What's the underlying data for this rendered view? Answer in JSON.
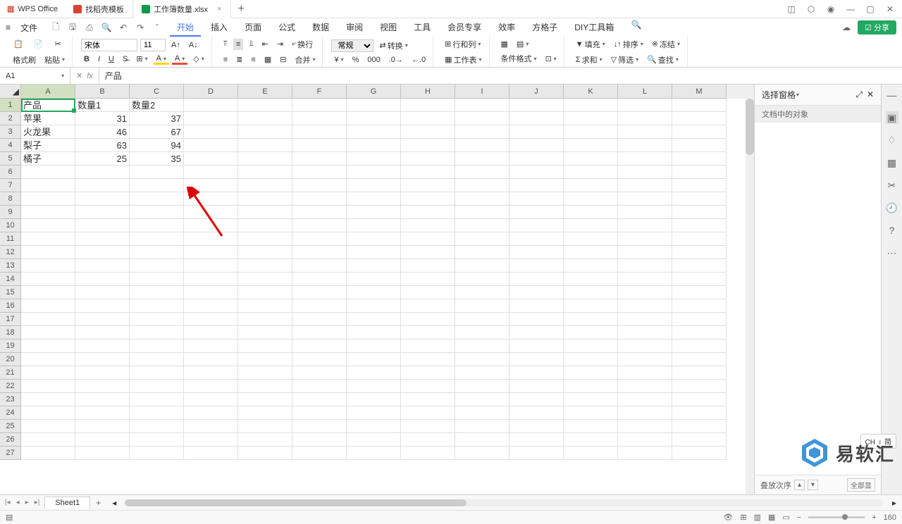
{
  "title_bar": {
    "app_name": "WPS Office",
    "tabs": [
      {
        "icon": "red",
        "label": "找稻壳模板",
        "closable": false
      },
      {
        "icon": "green",
        "label": "工作簿数量.xlsx",
        "closable": true
      }
    ]
  },
  "menu": {
    "file": "文件",
    "tabs": [
      "开始",
      "插入",
      "页面",
      "公式",
      "数据",
      "审阅",
      "视图",
      "工具",
      "会员专享",
      "效率",
      "方格子",
      "DIY工具箱"
    ],
    "active_tab": "开始",
    "share": "分享"
  },
  "ribbon": {
    "format_painter": "格式刷",
    "paste": "粘贴",
    "font_name": "宋体",
    "font_size": "11",
    "wrap": "换行",
    "number_format": "常规",
    "convert": "转换",
    "rows_cols": "行和列",
    "worksheet": "工作表",
    "cond_format": "条件格式",
    "fill": "填充",
    "sort": "排序",
    "freeze": "冻结",
    "sum": "求和",
    "filter": "筛选",
    "find": "查找"
  },
  "formula_bar": {
    "name_box": "A1",
    "formula": "产品"
  },
  "columns": [
    "A",
    "B",
    "C",
    "D",
    "E",
    "F",
    "G",
    "H",
    "I",
    "J",
    "K",
    "L",
    "M"
  ],
  "rows": [
    {
      "n": 1,
      "cells": [
        "产品",
        "数量1",
        "数量2",
        "",
        "",
        "",
        "",
        "",
        "",
        "",
        "",
        "",
        ""
      ],
      "types": [
        "text",
        "text",
        "text",
        "",
        "",
        "",
        "",
        "",
        "",
        "",
        "",
        "",
        ""
      ]
    },
    {
      "n": 2,
      "cells": [
        "苹果",
        "31",
        "37",
        "",
        "",
        "",
        "",
        "",
        "",
        "",
        "",
        "",
        ""
      ],
      "types": [
        "text",
        "num",
        "num",
        "",
        "",
        "",
        "",
        "",
        "",
        "",
        "",
        "",
        ""
      ]
    },
    {
      "n": 3,
      "cells": [
        "火龙果",
        "46",
        "67",
        "",
        "",
        "",
        "",
        "",
        "",
        "",
        "",
        "",
        ""
      ],
      "types": [
        "text",
        "num",
        "num",
        "",
        "",
        "",
        "",
        "",
        "",
        "",
        "",
        "",
        ""
      ]
    },
    {
      "n": 4,
      "cells": [
        "梨子",
        "63",
        "94",
        "",
        "",
        "",
        "",
        "",
        "",
        "",
        "",
        "",
        ""
      ],
      "types": [
        "text",
        "num",
        "num",
        "",
        "",
        "",
        "",
        "",
        "",
        "",
        "",
        "",
        ""
      ]
    },
    {
      "n": 5,
      "cells": [
        "橘子",
        "25",
        "35",
        "",
        "",
        "",
        "",
        "",
        "",
        "",
        "",
        "",
        ""
      ],
      "types": [
        "text",
        "num",
        "num",
        "",
        "",
        "",
        "",
        "",
        "",
        "",
        "",
        "",
        ""
      ]
    }
  ],
  "empty_rows": [
    6,
    7,
    8,
    9,
    10,
    11,
    12,
    13,
    14,
    15,
    16,
    17,
    18,
    19,
    20,
    21,
    22,
    23,
    24,
    25,
    26,
    27
  ],
  "side_panel": {
    "title": "选择窗格",
    "subtitle": "文档中的对象",
    "footer_label": "叠放次序",
    "footer_btn": "全部显"
  },
  "sheet": {
    "name": "Sheet1"
  },
  "status": {
    "zoom": "160"
  },
  "ime": "CH ♀ 简",
  "watermark": "易软汇",
  "selected_cell": {
    "row": 1,
    "col": 0
  }
}
